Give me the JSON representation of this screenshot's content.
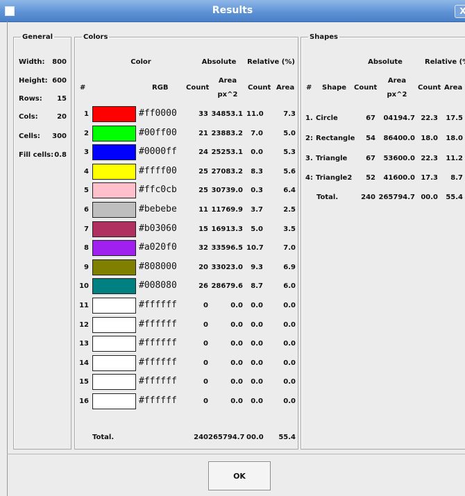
{
  "window": {
    "title": "Results",
    "close_glyph": "X"
  },
  "general": {
    "legend": "General",
    "rows": [
      {
        "label": "Width:",
        "value": "800"
      },
      {
        "label": "Height:",
        "value": "600"
      },
      {
        "label": "Rows:",
        "value": "15"
      },
      {
        "label": "Cols:",
        "value": "20"
      },
      {
        "label": "Cells:",
        "value": "300"
      },
      {
        "label": "Fill cells:",
        "value": "0.8"
      }
    ]
  },
  "colors": {
    "legend": "Colors",
    "header": {
      "color": "Color",
      "absolute": "Absolute",
      "relative": "Relative (%)",
      "num": "#",
      "rgb": "RGB",
      "count": "Count",
      "area_top": "Area",
      "area_bottom": "px^2",
      "rel_count": "Count",
      "rel_area": "Area"
    },
    "rows": [
      {
        "n": "1",
        "hex": "#ff0000",
        "swatch": "#ff0000",
        "count": "33",
        "area": "34853.1",
        "rc": "11.0",
        "ra": "7.3"
      },
      {
        "n": "2",
        "hex": "#00ff00",
        "swatch": "#00ff00",
        "count": "21",
        "area": "23883.2",
        "rc": "7.0",
        "ra": "5.0"
      },
      {
        "n": "3",
        "hex": "#0000ff",
        "swatch": "#0000ff",
        "count": "24",
        "area": "25253.1",
        "rc": "0.0",
        "ra": "5.3"
      },
      {
        "n": "4",
        "hex": "#ffff00",
        "swatch": "#ffff00",
        "count": "25",
        "area": "27083.2",
        "rc": "8.3",
        "ra": "5.6"
      },
      {
        "n": "5",
        "hex": "#ffc0cb",
        "swatch": "#ffc0cb",
        "count": "25",
        "area": "30739.0",
        "rc": "0.3",
        "ra": "6.4"
      },
      {
        "n": "6",
        "hex": "#bebebe",
        "swatch": "#bebebe",
        "count": "11",
        "area": "11769.9",
        "rc": "3.7",
        "ra": "2.5"
      },
      {
        "n": "7",
        "hex": "#b03060",
        "swatch": "#b03060",
        "count": "15",
        "area": "16913.3",
        "rc": "5.0",
        "ra": "3.5"
      },
      {
        "n": "8",
        "hex": "#a020f0",
        "swatch": "#a020f0",
        "count": "32",
        "area": "33596.5",
        "rc": "10.7",
        "ra": "7.0"
      },
      {
        "n": "9",
        "hex": "#808000",
        "swatch": "#808000",
        "count": "20",
        "area": "33023.0",
        "rc": "9.3",
        "ra": "6.9"
      },
      {
        "n": "10",
        "hex": "#008080",
        "swatch": "#008080",
        "count": "26",
        "area": "28679.6",
        "rc": "8.7",
        "ra": "6.0"
      },
      {
        "n": "11",
        "hex": "#ffffff",
        "swatch": "#ffffff",
        "count": "0",
        "area": "0.0",
        "rc": "0.0",
        "ra": "0.0"
      },
      {
        "n": "12",
        "hex": "#ffffff",
        "swatch": "#ffffff",
        "count": "0",
        "area": "0.0",
        "rc": "0.0",
        "ra": "0.0"
      },
      {
        "n": "13",
        "hex": "#ffffff",
        "swatch": "#ffffff",
        "count": "0",
        "area": "0.0",
        "rc": "0.0",
        "ra": "0.0"
      },
      {
        "n": "14",
        "hex": "#ffffff",
        "swatch": "#ffffff",
        "count": "0",
        "area": "0.0",
        "rc": "0.0",
        "ra": "0.0"
      },
      {
        "n": "15",
        "hex": "#ffffff",
        "swatch": "#ffffff",
        "count": "0",
        "area": "0.0",
        "rc": "0.0",
        "ra": "0.0"
      },
      {
        "n": "16",
        "hex": "#ffffff",
        "swatch": "#ffffff",
        "count": "0",
        "area": "0.0",
        "rc": "0.0",
        "ra": "0.0"
      }
    ],
    "total": {
      "label": "Total.",
      "count": "240",
      "area": "265794.7",
      "rc": "00.0",
      "ra": "55.4"
    }
  },
  "shapes": {
    "legend": "Shapes",
    "header": {
      "absolute": "Absolute",
      "relative": "Relative (%)",
      "num": "#",
      "shape": "Shape",
      "count": "Count",
      "area_top": "Area",
      "area_bottom": "px^2",
      "rel_count": "Count",
      "rel_area": "Area"
    },
    "rows": [
      {
        "n": "1.",
        "name": "Circle",
        "count": "67",
        "area": "04194.7",
        "rc": "22.3",
        "ra": "17.5"
      },
      {
        "n": "2:",
        "name": "Rectangle",
        "count": "54",
        "area": "86400.0",
        "rc": "18.0",
        "ra": "18.0"
      },
      {
        "n": "3.",
        "name": "Triangle",
        "count": "67",
        "area": "53600.0",
        "rc": "22.3",
        "ra": "11.2"
      },
      {
        "n": "4:",
        "name": "Triangle2",
        "count": "52",
        "area": "41600.0",
        "rc": "17.3",
        "ra": "8.7"
      }
    ],
    "total": {
      "label": "Total.",
      "count": "240",
      "area": "265794.7",
      "rc": "00.0",
      "ra": "55.4"
    }
  },
  "ok_button": "OK"
}
